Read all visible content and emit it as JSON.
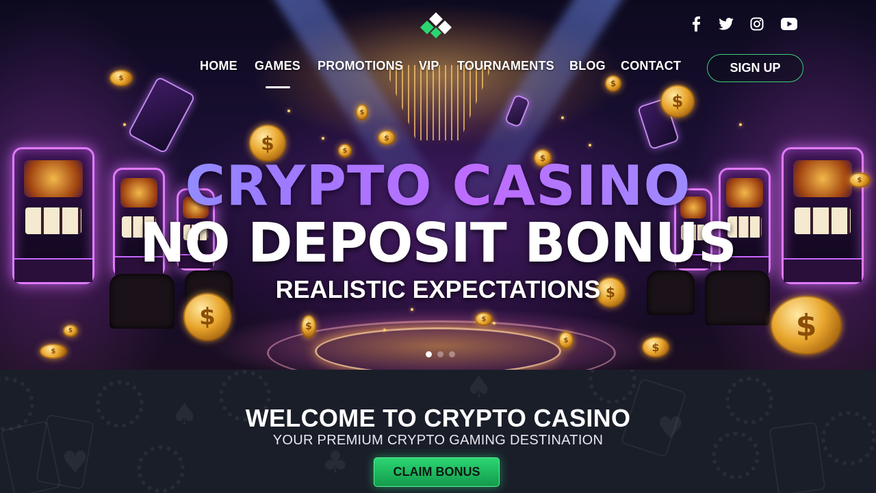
{
  "header": {
    "logo_icon": "diamond-logo-icon",
    "social": [
      {
        "name": "facebook",
        "icon": "facebook-icon",
        "glyph": "f"
      },
      {
        "name": "twitter",
        "icon": "twitter-icon",
        "glyph": ""
      },
      {
        "name": "instagram",
        "icon": "instagram-icon",
        "glyph": ""
      },
      {
        "name": "youtube",
        "icon": "youtube-icon",
        "glyph": ""
      }
    ],
    "nav": [
      "HOME",
      "GAMES",
      "PROMOTIONS",
      "VIP",
      "TOURNAMENTS",
      "BLOG",
      "CONTACT"
    ],
    "active_nav": "GAMES",
    "signup_label": "SIGN UP"
  },
  "hero": {
    "title_line1": "CRYPTO CASINO",
    "title_line2": "NO DEPOSIT BONUS",
    "subtitle": "REALISTIC EXPECTATIONS",
    "slide_count": 3,
    "active_slide": 1
  },
  "welcome": {
    "title": "WELCOME TO CRYPTO CASINO",
    "subtitle": "YOUR PREMIUM CRYPTO GAMING DESTINATION",
    "cta_label": "CLAIM BONUS"
  },
  "colors": {
    "accent_green": "#2bd672",
    "signup_border": "#37d27a",
    "title_gradient_start": "#7fb3ff",
    "title_gradient_mid": "#c06bff",
    "neon_purple": "#e07bff",
    "coin_gold": "#e8a52c",
    "section_bg": "#1a1e29"
  }
}
